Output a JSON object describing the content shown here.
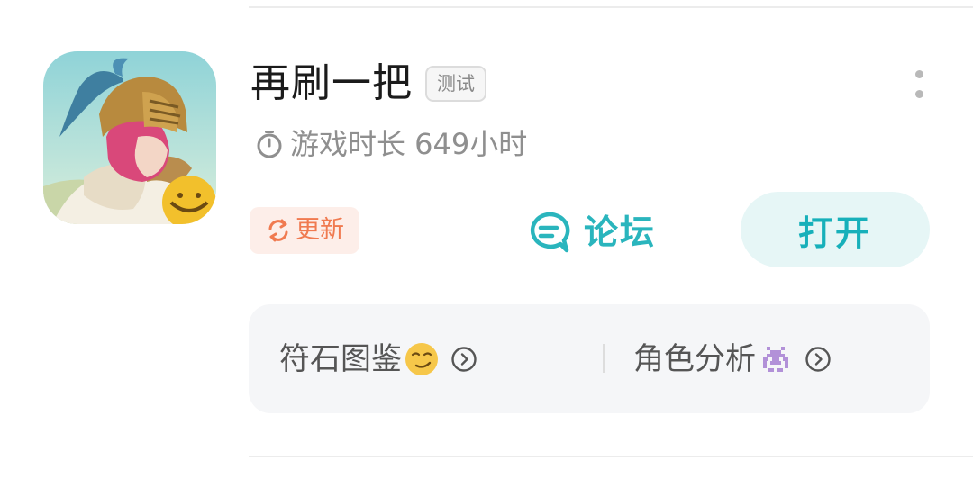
{
  "app": {
    "title": "再刷一把",
    "test_badge": "测试",
    "icon_name": "game-knight-icon"
  },
  "playtime": {
    "icon": "stopwatch-icon",
    "text": "游戏时长 649小时"
  },
  "update": {
    "icon": "refresh-icon",
    "label": "更新"
  },
  "forum": {
    "icon": "chat-bubble-icon",
    "label": "论坛"
  },
  "open_button": {
    "label": "打开"
  },
  "shortcuts": [
    {
      "label": "符石图鉴",
      "emoji": "smirk-emoji",
      "arrow": "chevron-right-circle-icon"
    },
    {
      "label": "角色分析",
      "emoji": "space-invader-emoji",
      "arrow": "chevron-right-circle-icon"
    }
  ],
  "colors": {
    "accent": "#17b0ba",
    "accent_bg": "#e6f6f6",
    "update_text": "#f07a50",
    "update_bg": "#fdeee9",
    "muted_text": "#8f8f8f",
    "panel_bg": "#f5f6f8"
  }
}
